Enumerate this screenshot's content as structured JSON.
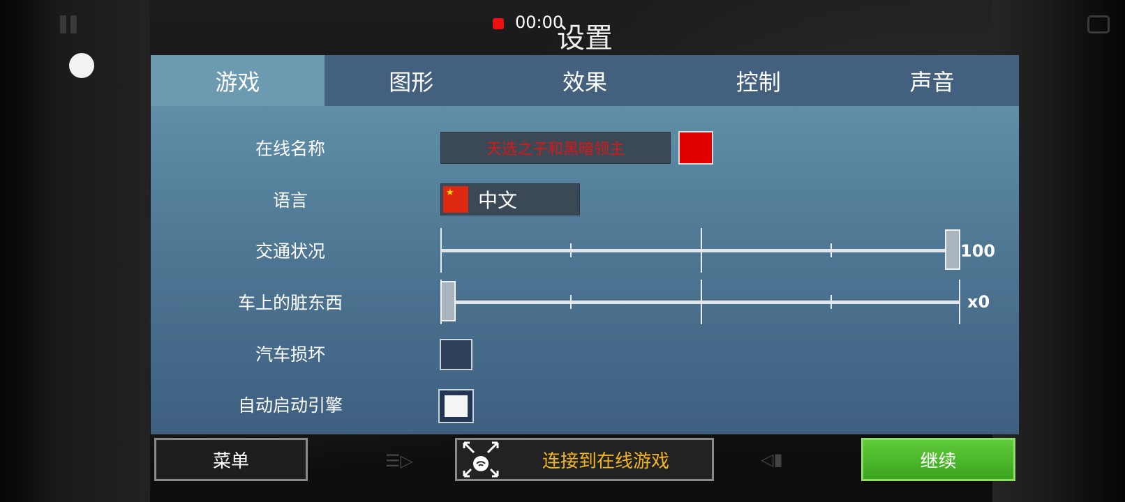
{
  "recording": {
    "time": "00:00"
  },
  "title": "设置",
  "tabs": [
    "游戏",
    "图形",
    "效果",
    "控制",
    "声音"
  ],
  "settings": {
    "online_name": {
      "label": "在线名称",
      "value": "天选之子和黑暗领主",
      "color": "#e10000"
    },
    "language": {
      "label": "语言",
      "value": "中文"
    },
    "traffic": {
      "label": "交通状况",
      "value_text": "100",
      "level": 1.0
    },
    "dirt": {
      "label": "车上的脏东西",
      "value_text": "x0",
      "level": 0.0
    },
    "car_damage": {
      "label": "汽车损坏",
      "checked": false
    },
    "auto_start": {
      "label": "自动启动引擎",
      "checked": true
    }
  },
  "buttons": {
    "menu": "菜单",
    "online": "连接到在线游戏",
    "continue": "继续"
  },
  "colors": {
    "accent_green": "#3aa51e",
    "online_text": "#f2b51e",
    "name_text": "#d91717"
  },
  "icons": {
    "pause": "pause-icon",
    "camera": "camera-icon",
    "online": "wifi-arrows-icon",
    "headlight": "headlight-icon",
    "horn": "horn-icon"
  }
}
